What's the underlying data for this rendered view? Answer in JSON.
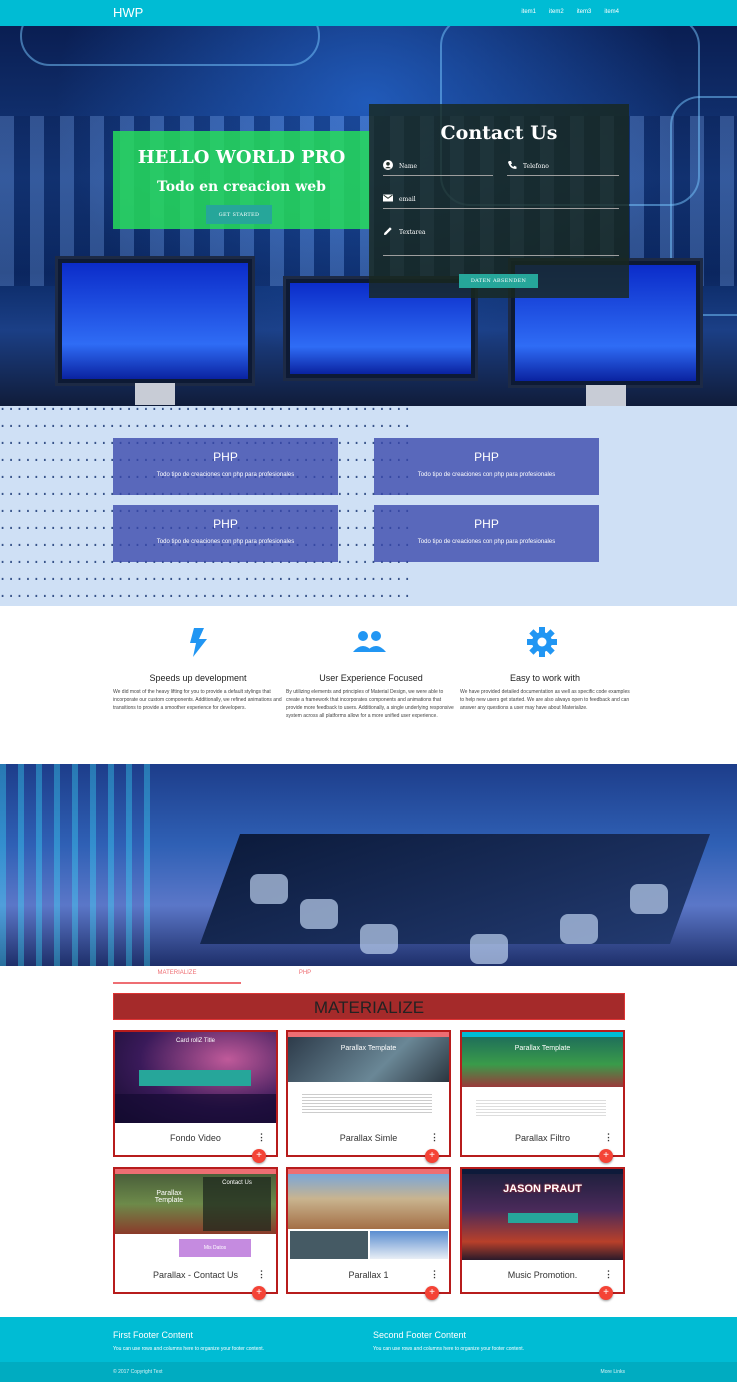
{
  "nav": {
    "brand": "HWP",
    "items": [
      "item1",
      "item2",
      "item3",
      "item4"
    ]
  },
  "hero": {
    "title": "HELLO WORLD PRO",
    "subtitle": "Todo en creacion web",
    "cta": "GET STARTED"
  },
  "contact": {
    "title": "Contact Us",
    "fields": {
      "name": "Name",
      "phone": "Telefono",
      "email": "email",
      "textarea": "Textarea"
    },
    "send": "DATEN ABSENDEN"
  },
  "php_cards": [
    {
      "title": "PHP",
      "text": "Todo tipo de creaciones con php para profesionales"
    },
    {
      "title": "PHP",
      "text": "Todo tipo de creaciones con php para profesionales"
    },
    {
      "title": "PHP",
      "text": "Todo tipo de creaciones con php para profesionales"
    },
    {
      "title": "PHP",
      "text": "Todo tipo de creaciones con php para profesionales"
    }
  ],
  "features": [
    {
      "icon": "flash-icon",
      "title": "Speeds up development",
      "text": "We did most of the heavy lifting for you to provide a default stylings that incorporate our custom components. Additionally, we refined animations and transitions to provide a smoother experience for developers."
    },
    {
      "icon": "group-icon",
      "title": "User Experience Focused",
      "text": "By utilizing elements and principles of Material Design, we were able to create a framework that incorporates components and animations that provide more feedback to users. Additionally, a single underlying responsive system across all platforms allow for a more unified user experience."
    },
    {
      "icon": "gear-icon",
      "title": "Easy to work with",
      "text": "We have provided detailed documentation as well as specific code examples to help new users get started. We are also always open to feedback and can answer any questions a user may have about Materialize."
    }
  ],
  "tabs": [
    "MATERIALIZE",
    "PHP"
  ],
  "banner": "MATERIALIZE",
  "cards": [
    {
      "title": "Fondo Video"
    },
    {
      "title": "Parallax Simle"
    },
    {
      "title": "Parallax Filtro"
    },
    {
      "title": "Parallax - Contact Us"
    },
    {
      "title": "Parallax 1"
    },
    {
      "title": "Music Promotion."
    }
  ],
  "card_thumbs": {
    "fondo": "Card rollZ Title",
    "parallax_template": "Parallax Template",
    "contact_us": "Contact Us",
    "mis_datos": "Mis Datos",
    "jason": "JASON PRAUT"
  },
  "footer": {
    "first_title": "First Footer Content",
    "first_text": "You can use rows and columns here to organize your footer content.",
    "second_title": "Second Footer Content",
    "second_text": "You can use rows and columns here to organize your footer content.",
    "copyright": "© 2017 Copyright Text",
    "more_links": "More Links"
  },
  "colors": {
    "nav": "#00bcd4",
    "teal": "#26a69a",
    "accent_red": "#f44336",
    "banner": "#a52a2a"
  }
}
